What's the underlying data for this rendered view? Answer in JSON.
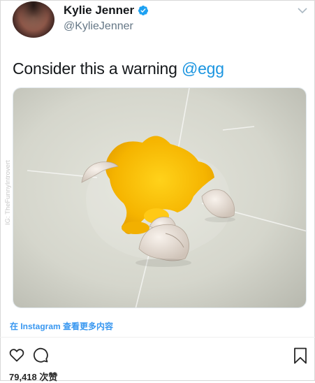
{
  "tweet": {
    "display_name": "Kylie Jenner",
    "handle": "@KylieJenner",
    "verified": true,
    "text_prefix": "Consider this a warning ",
    "mention": "@egg",
    "avatar_icon": "profile-photo",
    "menu_icon": "chevron-down-icon"
  },
  "media": {
    "watermark": "IG: TheFunnyIntrovert"
  },
  "instagram": {
    "view_more_link": "在 Instagram 查看更多内容",
    "likes": "79,418 次赞",
    "icons": [
      "heart-icon",
      "comment-icon",
      "bookmark-icon"
    ]
  },
  "colors": {
    "link_blue": "#1b95e0",
    "instagram_blue": "#3897f0",
    "verified_blue": "#1da1f2",
    "text_dark": "#14171a",
    "handle_gray": "#657786"
  }
}
